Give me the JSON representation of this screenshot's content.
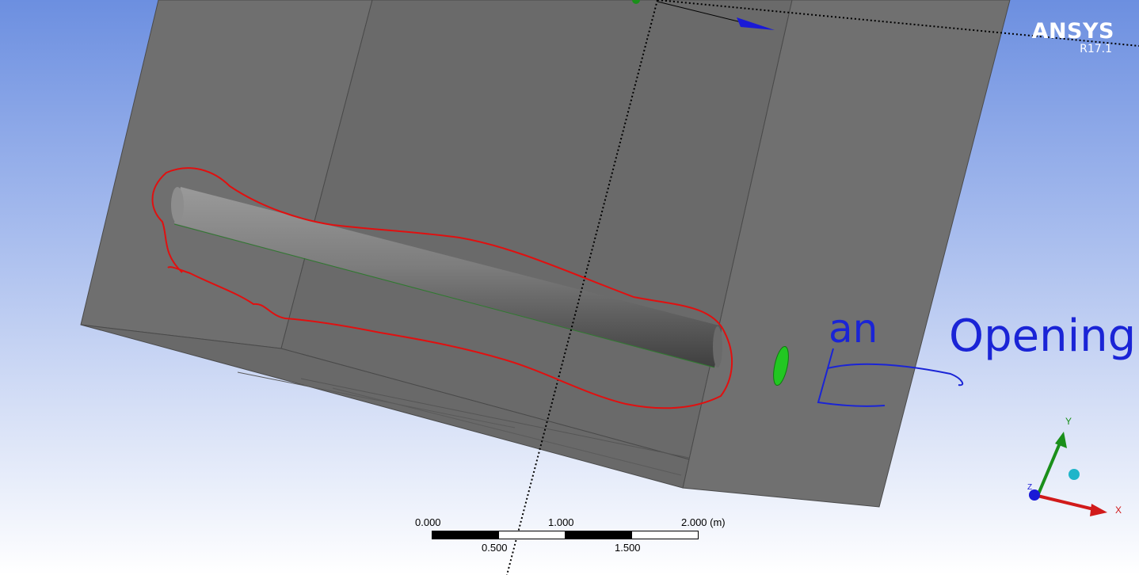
{
  "viewer": {
    "brand": "ANSYS",
    "version": "R17.1"
  },
  "scale_bar": {
    "unit_label": "2.000 (m)",
    "top_ticks": [
      "0.000",
      "1.000"
    ],
    "bottom_ticks": [
      "0.500",
      "1.500"
    ]
  },
  "triad": {
    "x_label": "X",
    "y_label": "Y",
    "z_label": "Z",
    "colors": {
      "x": "#d11a1a",
      "y": "#1a8f1a",
      "z": "#1a1ad6",
      "iso": "#1fb5c9"
    }
  },
  "annotation": {
    "text_1": "an",
    "text_2": "Opening",
    "highlight_color": "#e01010",
    "text_color": "#1a24d6"
  },
  "colors": {
    "box_face": "#6e6e6e",
    "box_face_dark": "#636363",
    "inlet_green": "#22c722"
  }
}
